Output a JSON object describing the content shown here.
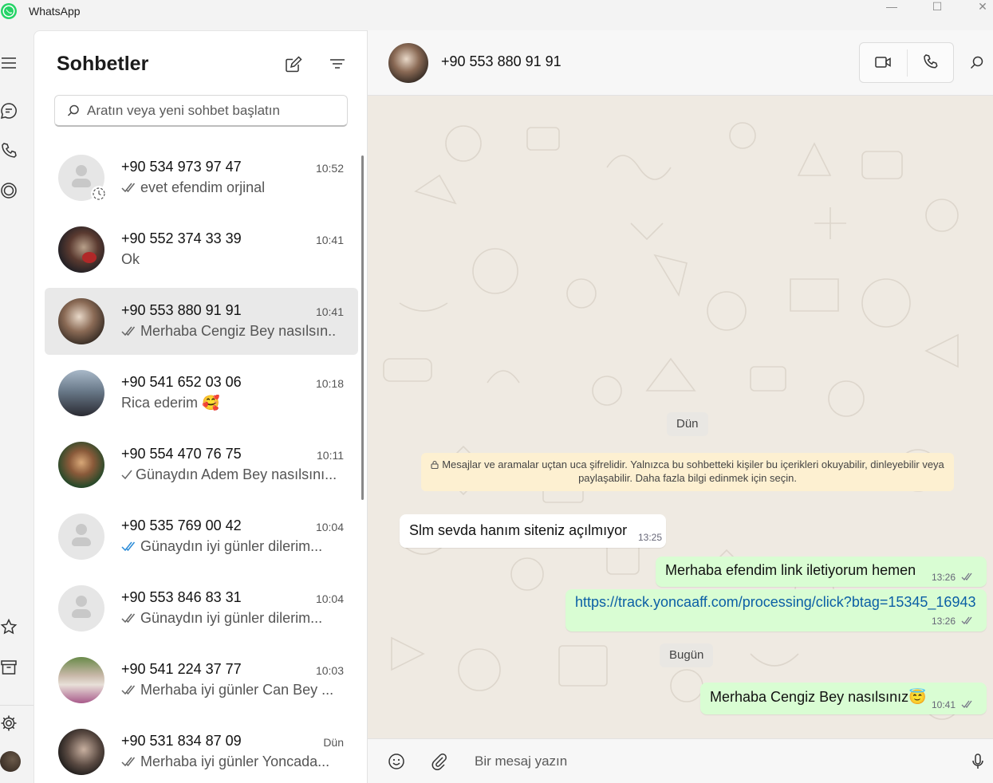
{
  "window": {
    "title": "WhatsApp",
    "minimize": "—",
    "maximize": "☐",
    "close": "✕"
  },
  "sidebar": {
    "title": "Sohbetler",
    "search_placeholder": "Aratın veya yeni sohbet başlatın",
    "chats": [
      {
        "name": "+90 534 973 97 47",
        "time": "10:52",
        "preview": "evet efendim orjinal",
        "tick": "double-grey"
      },
      {
        "name": "+90 552 374 33 39",
        "time": "10:41",
        "preview": "Ok",
        "tick": "none"
      },
      {
        "name": "+90 553 880 91 91",
        "time": "10:41",
        "preview": "Merhaba Cengiz Bey nasılsın...",
        "tick": "double-grey"
      },
      {
        "name": "+90 541 652 03 06",
        "time": "10:18",
        "preview": "Rica ederim 🥰",
        "tick": "none"
      },
      {
        "name": "+90 554 470 76 75",
        "time": "10:11",
        "preview": "Günaydın Adem Bey nasılsını...",
        "tick": "single-grey"
      },
      {
        "name": "+90 535 769 00 42",
        "time": "10:04",
        "preview": "Günaydın iyi günler dilerim...",
        "tick": "double-blue"
      },
      {
        "name": "+90 553 846 83 31",
        "time": "10:04",
        "preview": "Günaydın iyi günler dilerim...",
        "tick": "double-grey"
      },
      {
        "name": "+90 541 224 37 77",
        "time": "10:03",
        "preview": "Merhaba iyi günler Can Bey ...",
        "tick": "double-grey"
      },
      {
        "name": "+90 531 834 87 09",
        "time": "Dün",
        "preview": "Merhaba iyi günler Yoncada...",
        "tick": "double-grey"
      }
    ]
  },
  "conversation": {
    "contact_name": "+90 553 880 91 91",
    "date_yesterday": "Dün",
    "encryption_notice": "Mesajlar ve aramalar uçtan uca şifrelidir. Yalnızca bu sohbetteki kişiler bu içerikleri okuyabilir, dinleyebilir veya paylaşabilir. Daha fazla bilgi edinmek için seçin.",
    "date_today": "Bugün",
    "messages": [
      {
        "direction": "in",
        "text": "Slm sevda hanım siteniz açılmıyor",
        "time": "13:25"
      },
      {
        "direction": "out",
        "text": "Merhaba efendim link iletiyorum hemen",
        "time": "13:26"
      },
      {
        "direction": "out",
        "text": "https://track.yoncaaff.com/processing/click?btag=15345_16943",
        "time": "13:26"
      },
      {
        "direction": "out",
        "text": "Merhaba Cengiz Bey nasılsınız😇",
        "time": "10:41"
      }
    ],
    "composer_placeholder": "Bir mesaj yazın"
  },
  "colors": {
    "accent": "#25d366",
    "outgoing_bubble": "#d9fdd3",
    "read_tick_blue": "#53bdeb",
    "wallpaper": "#efeae2"
  }
}
